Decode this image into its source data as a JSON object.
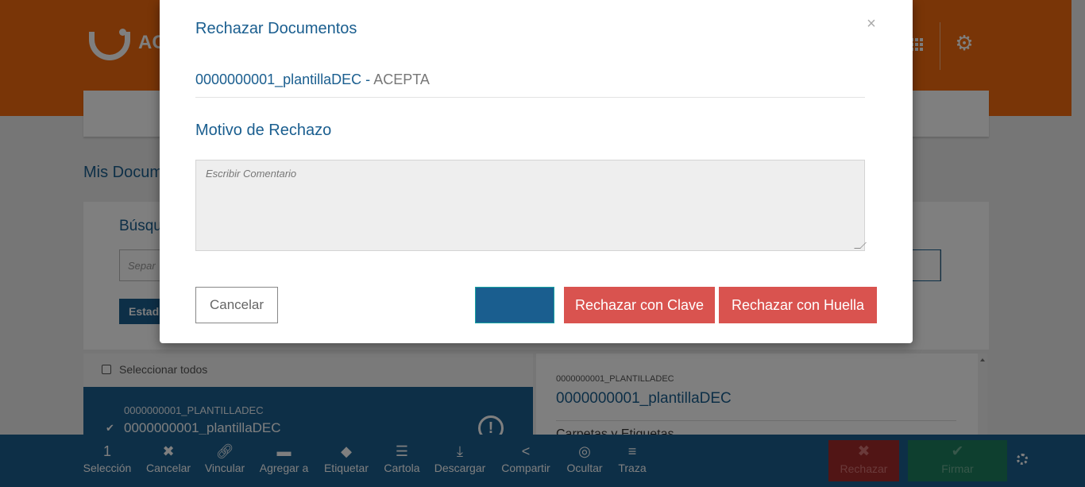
{
  "app": {
    "logo_text": "AC",
    "page_title": "Mis Docum",
    "search_title": "Búsqu",
    "search_placeholder": "Separ",
    "state_button": "Estad"
  },
  "list": {
    "select_all": "Seleccionar todos",
    "selected_row": {
      "code": "0000000001_PLANTILLADEC",
      "name": "0000000001_plantillaDEC"
    }
  },
  "detail": {
    "code": "0000000001_PLANTILLADEC",
    "name": "0000000001_plantillaDEC",
    "section": "Carpetas y Etiquetas"
  },
  "toolbar": {
    "count": "1",
    "items": [
      {
        "label": "Selección",
        "icon": "selection-count"
      },
      {
        "label": "Cancelar",
        "icon": "close-icon"
      },
      {
        "label": "Vincular",
        "icon": "link-icon"
      },
      {
        "label": "Agregar a",
        "icon": "folder-icon"
      },
      {
        "label": "Etiquetar",
        "icon": "tag-icon"
      },
      {
        "label": "Cartola",
        "icon": "list-alt-icon"
      },
      {
        "label": "Descargar",
        "icon": "download-icon"
      },
      {
        "label": "Compartir",
        "icon": "share-icon"
      },
      {
        "label": "Ocultar",
        "icon": "eye-slash-icon"
      },
      {
        "label": "Traza",
        "icon": "list-icon"
      }
    ],
    "reject_label": "Rechazar",
    "sign_label": "Firmar"
  },
  "modal": {
    "title": "Rechazar Documentos",
    "close": "×",
    "document_name": "0000000001_plantillaDEC",
    "document_separator": " - ",
    "document_status": "ACEPTA",
    "reason_title": "Motivo de Rechazo",
    "comment_placeholder": "Escribir Comentario",
    "cancel_label": "Cancelar",
    "confirm_label": "",
    "reject_key_label": "Rechazar con Clave",
    "reject_print_label": "Rechazar con Huella"
  },
  "colors": {
    "brand_orange": "#f26b0e",
    "primary_blue": "#1a5e8f",
    "danger_red": "#d9534f",
    "success_green": "#1d7f5e"
  }
}
